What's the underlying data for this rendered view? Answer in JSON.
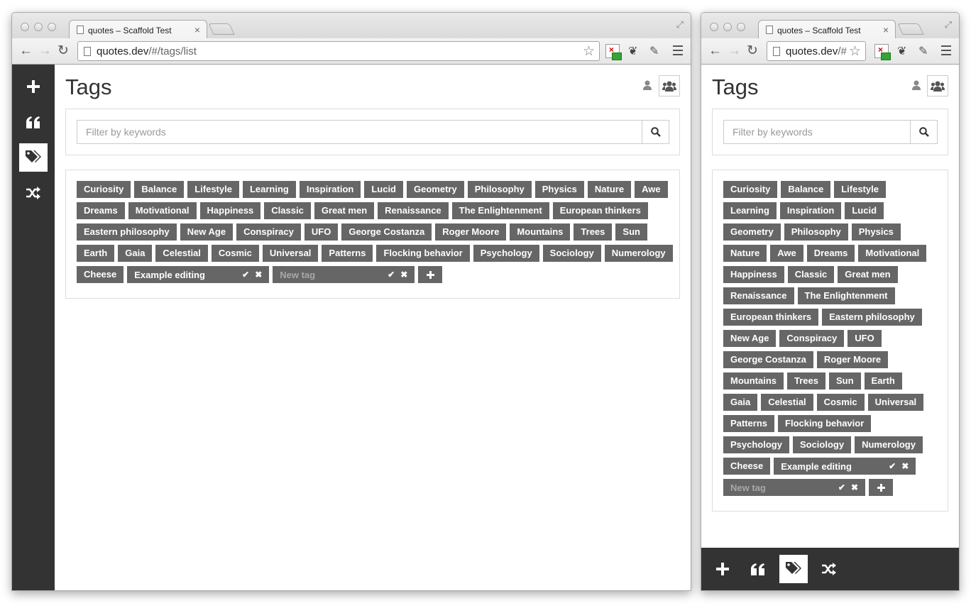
{
  "browser": {
    "tab_title": "quotes – Scaffold Test",
    "tab_close": "×",
    "url_host": "quotes.dev",
    "url_path": "/#/tags/list",
    "url_path_short": "/#"
  },
  "nav": {
    "items": [
      {
        "name": "add-icon"
      },
      {
        "name": "quote-icon"
      },
      {
        "name": "tags-icon",
        "active": true
      },
      {
        "name": "random-icon"
      }
    ]
  },
  "page": {
    "title": "Tags",
    "search_placeholder": "Filter by keywords"
  },
  "tags": [
    "Curiosity",
    "Balance",
    "Lifestyle",
    "Learning",
    "Inspiration",
    "Lucid",
    "Geometry",
    "Philosophy",
    "Physics",
    "Nature",
    "Awe",
    "Dreams",
    "Motivational",
    "Happiness",
    "Classic",
    "Great men",
    "Renaissance",
    "The Enlightenment",
    "European thinkers",
    "Eastern philosophy",
    "New Age",
    "Conspiracy",
    "UFO",
    "George Costanza",
    "Roger Moore",
    "Mountains",
    "Trees",
    "Sun",
    "Earth",
    "Gaia",
    "Celestial",
    "Cosmic",
    "Universal",
    "Patterns",
    "Flocking behavior",
    "Psychology",
    "Sociology",
    "Numerology",
    "Cheese"
  ],
  "editing_tag": {
    "value": "Example editing"
  },
  "new_tag": {
    "placeholder": "New tag"
  },
  "colors": {
    "sidebar": "#333333",
    "tag": "#666666",
    "text": "#333333"
  }
}
